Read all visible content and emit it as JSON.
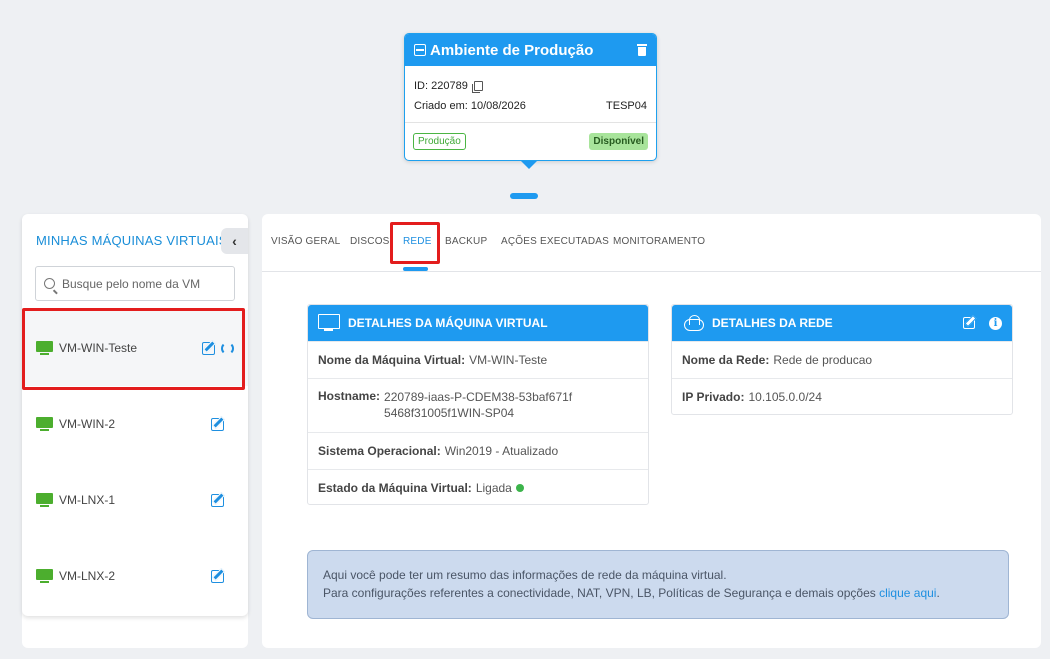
{
  "environment": {
    "title": "Ambiente de Produção",
    "id_label": "ID: 220789",
    "created_label": "Criado em: 10/08/2026",
    "code": "TESP04",
    "tag": "Produção",
    "status": "Disponível"
  },
  "sidebar": {
    "title": "MINHAS MÁQUINAS VIRTUAIS",
    "search_placeholder": "Busque pelo nome da VM",
    "items": [
      {
        "name": "VM-WIN-Teste"
      },
      {
        "name": "VM-WIN-2"
      },
      {
        "name": "VM-LNX-1"
      },
      {
        "name": "VM-LNX-2"
      }
    ]
  },
  "tabs": [
    {
      "label": "VISÃO GERAL"
    },
    {
      "label": "DISCOS"
    },
    {
      "label": "REDE"
    },
    {
      "label": "BACKUP"
    },
    {
      "label": "AÇÕES EXECUTADAS"
    },
    {
      "label": "MONITORAMENTO"
    }
  ],
  "vm_details": {
    "title": "DETALHES DA MÁQUINA VIRTUAL",
    "rows": [
      {
        "label": "Nome da Máquina Virtual:",
        "value": "VM-WIN-Teste"
      },
      {
        "label": "Hostname:",
        "value": "220789-iaas-P-CDEM38-53baf671f5468f31005f1WIN-SP04"
      },
      {
        "label": "Sistema Operacional:",
        "value": "Win2019 - Atualizado"
      },
      {
        "label": "Estado da Máquina Virtual:",
        "value": "Ligada"
      }
    ]
  },
  "network_details": {
    "title": "DETALHES DA REDE",
    "rows": [
      {
        "label": "Nome da Rede:",
        "value": "Rede de producao"
      },
      {
        "label": "IP Privado:",
        "value": "10.105.0.0/24"
      }
    ]
  },
  "info": {
    "line1": "Aqui você pode ter um resumo das informações de rede da máquina virtual.",
    "line2": "Para configurações referentes a conectividade, NAT, VPN, LB, Políticas de Segurança e demais opções ",
    "link": "clique aqui",
    "tail": "."
  },
  "colors": {
    "accent": "#1e9af0",
    "highlight": "#e31d1d",
    "vm_icon": "#4cae2e"
  }
}
